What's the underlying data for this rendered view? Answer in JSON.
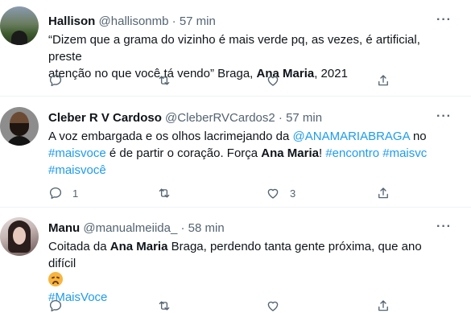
{
  "tweets": [
    {
      "name": "Hallison",
      "handle": "@hallisonmb",
      "sep": "·",
      "time": "57 min",
      "text_1": "“Dizem que a grama do vizinho é mais verde pq, as vezes, é artificial, preste",
      "text_2a": "atenção no que você tá vendo” Braga, ",
      "text_2b": "Ana Maria",
      "text_2c": ", 2021",
      "reply_count": "",
      "retweet_count": "",
      "like_count": ""
    },
    {
      "name": "Cleber R V Cardoso",
      "handle": "@CleberRVCardos2",
      "sep": "·",
      "time": "57 min",
      "line1a": "A voz embargada e os olhos lacrimejando da ",
      "line1_mention": "@ANAMARIABRAGA",
      "line1b": " no",
      "line2_tag": "#maisvoce",
      "line2a": " é de partir o coração. Força ",
      "line2_bold": "Ana Maria",
      "line2b": "! ",
      "line2_tag2": "#encontro",
      "line2_sp": " ",
      "line2_tag3": "#maisvc",
      "line3_tag": "#maisvocê",
      "reply_count": "1",
      "like_count": "3"
    },
    {
      "name": "Manu",
      "handle": "@manualmeiida_",
      "sep": "·",
      "time": "58 min",
      "line1a": "Coitada da ",
      "line1_bold": "Ana Maria",
      "line1b": " Braga, perdendo tanta gente próxima, que ano difícil",
      "emoji": "disappointed-face",
      "line3_tag": "#MaisVoce"
    }
  ],
  "more_label": "···",
  "colors": {
    "link": "#1d9bf0",
    "secondary": "#536471",
    "text": "#0f1419"
  }
}
